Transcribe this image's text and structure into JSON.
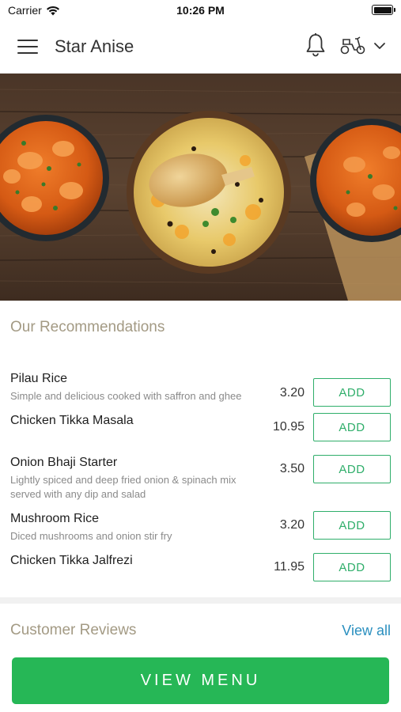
{
  "status_bar": {
    "carrier": "Carrier",
    "time": "10:26 PM"
  },
  "header": {
    "title": "Star Anise",
    "icons": [
      "menu-icon",
      "bell-icon",
      "scooter-icon",
      "chevron-down-icon"
    ]
  },
  "hero": {
    "image": "food-banner-curries-and-biryani"
  },
  "recommendations": {
    "title": "Our Recommendations",
    "add_label": "ADD",
    "items": [
      {
        "name": "Pilau Rice",
        "description": "Simple and delicious cooked with saffron and ghee",
        "price": "3.20"
      },
      {
        "name": "Chicken Tikka Masala",
        "description": "",
        "price": "10.95"
      },
      {
        "name": "Onion Bhaji Starter",
        "description": "Lightly spiced and deep fried onion & spinach mix served with any dip and salad",
        "price": "3.50"
      },
      {
        "name": "Mushroom Rice",
        "description": "Diced mushrooms and onion stir fry",
        "price": "3.20"
      },
      {
        "name": "Chicken Tikka Jalfrezi",
        "description": "",
        "price": "11.95"
      }
    ]
  },
  "reviews": {
    "title": "Customer Reviews",
    "view_all": "View all"
  },
  "footer": {
    "view_menu": "VIEW MENU"
  },
  "colors": {
    "accent_green": "#26b756",
    "add_outline": "#2fae6a",
    "section_title": "#a39a84",
    "link_blue": "#2a8fbf"
  }
}
